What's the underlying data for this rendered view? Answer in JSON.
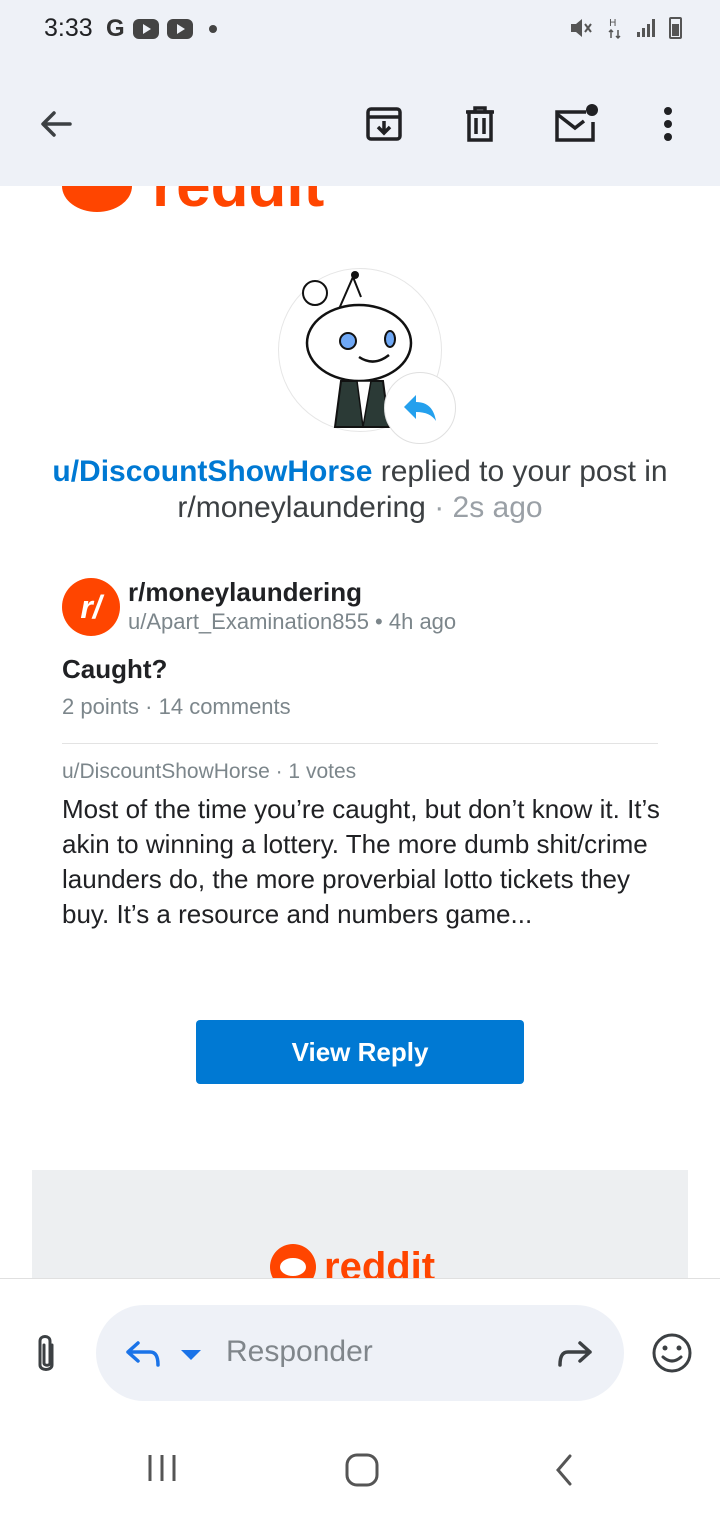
{
  "status_bar": {
    "time": "3:33",
    "g_label": "G"
  },
  "app_bar": {
    "icons": [
      "back-icon",
      "archive-icon",
      "delete-icon",
      "mark-unread-icon",
      "more-options-icon"
    ]
  },
  "email": {
    "top_logo_text": "reddit",
    "headline": {
      "user": "u/DiscountShowHorse",
      "action": " replied to your post in ",
      "subreddit": "r/moneylaundering",
      "separator": " · ",
      "time": "2s ago"
    },
    "post": {
      "subreddit_icon_text": "r/",
      "subreddit": "r/moneylaundering",
      "meta": "u/Apart_Examination855 • 4h ago",
      "title": "Caught?",
      "stats": "2 points · 14 comments"
    },
    "comment": {
      "meta": "u/DiscountShowHorse · 1 votes",
      "body": "Most of the time you’re caught, but don’t know it. It’s akin to winning a lottery. The more dumb shit/crime launders do, the more proverbial lotto tickets they buy. It’s a resource and numbers game..."
    },
    "view_reply_label": "View Reply",
    "footer_logo_text": "reddit"
  },
  "compose": {
    "placeholder": "Responder"
  },
  "colors": {
    "reddit_orange": "#ff4500",
    "reddit_blue": "#0079d3",
    "app_bar_bg": "#eef1f7"
  }
}
